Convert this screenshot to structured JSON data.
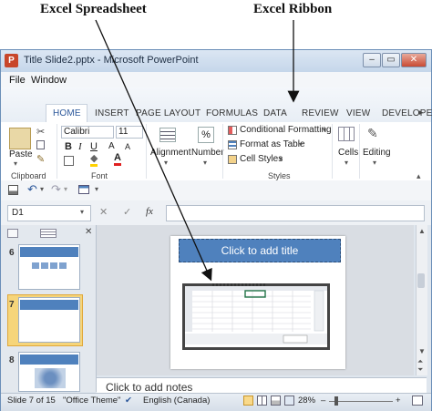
{
  "annotations": {
    "spreadsheet_label": "Excel Spreadsheet",
    "ribbon_label": "Excel Ribbon"
  },
  "window": {
    "title": "Title Slide2.pptx - Microsoft PowerPoint",
    "app_icon_letter": "P",
    "min_symbol": "–",
    "max_symbol": "▭",
    "close_symbol": "✕"
  },
  "menu": [
    "File",
    "Window"
  ],
  "ribbon_tabs": [
    "HOME",
    "INSERT",
    "PAGE LAYOUT",
    "FORMULAS",
    "DATA",
    "REVIEW",
    "VIEW",
    "DEVELOPER"
  ],
  "ribbon": {
    "paste_label": "Paste",
    "font_name": "Calibri",
    "font_size": "11",
    "alignment_label": "Alignment",
    "number_label": "Number",
    "conditional_formatting": "Conditional Formatting",
    "format_as_table": "Format as Table",
    "cell_styles": "Cell Styles",
    "cells_label": "Cells",
    "editing_label": "Editing",
    "groups": {
      "clipboard": "Clipboard",
      "font": "Font",
      "styles": "Styles"
    }
  },
  "formula_bar": {
    "name_box": "D1",
    "cancel_symbol": "✕",
    "enter_symbol": "✓",
    "fx_symbol": "fx"
  },
  "slides": [
    {
      "number": "6"
    },
    {
      "number": "7"
    },
    {
      "number": "8"
    }
  ],
  "slide": {
    "title_placeholder": "Click to add title"
  },
  "notes_placeholder": "Click to add notes",
  "status": {
    "slide_info": "Slide 7 of 15",
    "theme": "\"Office Theme\"",
    "language": "English (Canada)",
    "zoom": "28%",
    "zoom_minus": "–",
    "zoom_plus": "+"
  },
  "colors": {
    "accent_blue": "#4f81bd",
    "active_tab_text": "#2b579a"
  }
}
